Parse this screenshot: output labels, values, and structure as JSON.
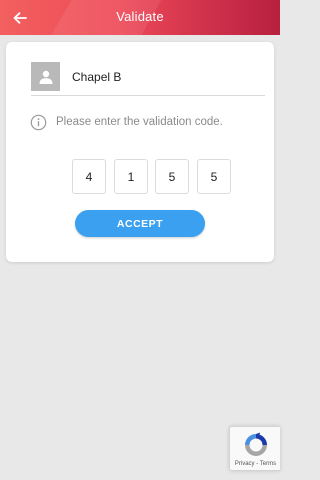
{
  "header": {
    "title": "Validate",
    "back_icon": "arrow-left-icon",
    "gradient_colors": [
      "#f2605f",
      "#ee4a58",
      "#d2334c",
      "#b8203f"
    ]
  },
  "card": {
    "user_name": "Chapel B",
    "avatar_icon": "person-icon",
    "info_icon": "info-circle-icon",
    "info_text": "Please enter the validation code.",
    "code_digits": [
      "4",
      "1",
      "5",
      "5"
    ],
    "accept_label": "ACCEPT",
    "accept_color": "#3aa0ef"
  },
  "recaptcha": {
    "icon": "recaptcha-icon",
    "privacy_label": "Privacy",
    "separator": " - ",
    "terms_label": "Terms"
  }
}
